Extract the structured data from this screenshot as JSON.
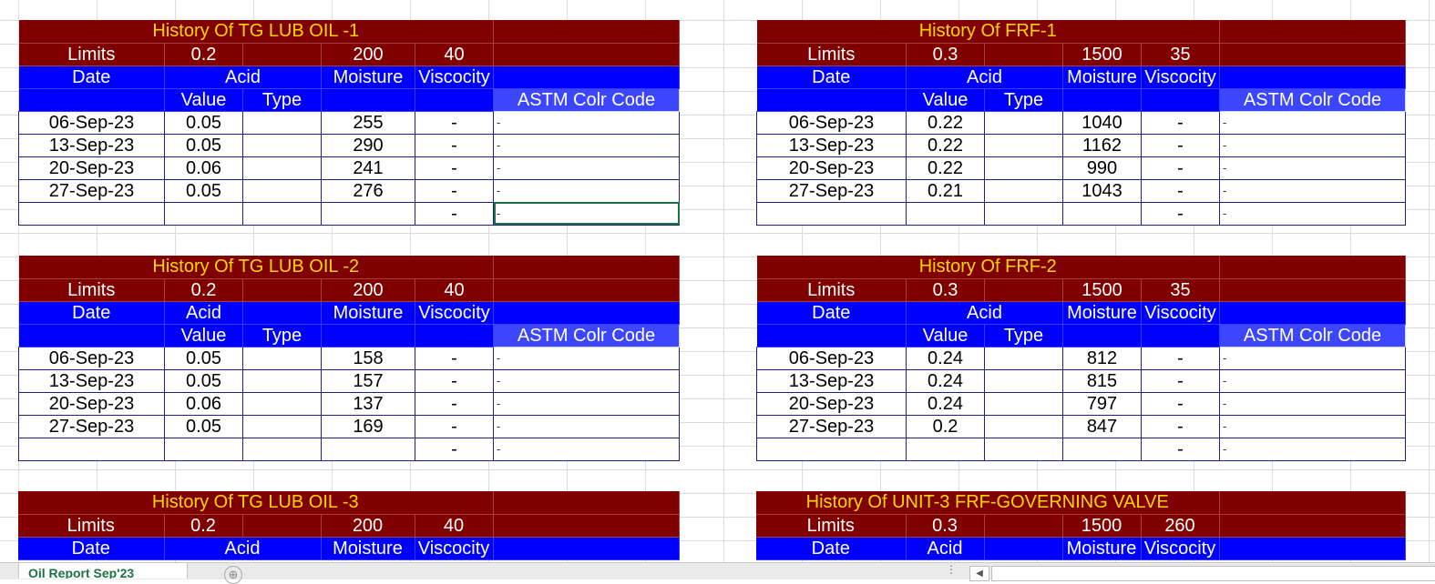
{
  "tables": {
    "t1": {
      "title": "History Of TG LUB OIL -1",
      "limits": {
        "label": "Limits",
        "acid": "0.2",
        "moisture": "200",
        "viscosity": "40"
      },
      "headers": {
        "date": "Date",
        "acid": "Acid",
        "moisture": "Moisture",
        "viscosity": "Viscocity",
        "value": "Value",
        "type": "Type",
        "astm": "ASTM Colr Code"
      },
      "rows": [
        {
          "date": "06-Sep-23",
          "value": "0.05",
          "moisture": "255",
          "viscosity": "-",
          "astm": "-"
        },
        {
          "date": "13-Sep-23",
          "value": "0.05",
          "moisture": "290",
          "viscosity": "-",
          "astm": "-"
        },
        {
          "date": "20-Sep-23",
          "value": "0.06",
          "moisture": "241",
          "viscosity": "-",
          "astm": "-"
        },
        {
          "date": "27-Sep-23",
          "value": "0.05",
          "moisture": "276",
          "viscosity": "-",
          "astm": "-"
        },
        {
          "date": "",
          "value": "",
          "moisture": "",
          "viscosity": "-",
          "astm": "-"
        }
      ]
    },
    "t2": {
      "title": "History Of FRF-1",
      "limits": {
        "label": "Limits",
        "acid": "0.3",
        "moisture": "1500",
        "viscosity": "35"
      },
      "headers": {
        "date": "Date",
        "acid": "Acid",
        "moisture": "Moisture",
        "viscosity": "Viscocity",
        "value": "Value",
        "type": "Type",
        "astm": "ASTM Colr Code"
      },
      "rows": [
        {
          "date": "06-Sep-23",
          "value": "0.22",
          "moisture": "1040",
          "viscosity": "-",
          "astm": "-"
        },
        {
          "date": "13-Sep-23",
          "value": "0.22",
          "moisture": "1162",
          "viscosity": "-",
          "astm": "-"
        },
        {
          "date": "20-Sep-23",
          "value": "0.22",
          "moisture": "990",
          "viscosity": "-",
          "astm": "-"
        },
        {
          "date": "27-Sep-23",
          "value": "0.21",
          "moisture": "1043",
          "viscosity": "-",
          "astm": "-"
        },
        {
          "date": "",
          "value": "",
          "moisture": "",
          "viscosity": "-",
          "astm": "-"
        }
      ]
    },
    "t3": {
      "title": "History Of TG LUB OIL -2",
      "limits": {
        "label": "Limits",
        "acid": "0.2",
        "moisture": "200",
        "viscosity": "40"
      },
      "headers": {
        "date": "Date",
        "acid": "Acid",
        "moisture": "Moisture",
        "viscosity": "Viscocity",
        "value": "Value",
        "type": "Type",
        "astm": "ASTM Colr Code"
      },
      "rows": [
        {
          "date": "06-Sep-23",
          "value": "0.05",
          "moisture": "158",
          "viscosity": "-",
          "astm": "-"
        },
        {
          "date": "13-Sep-23",
          "value": "0.05",
          "moisture": "157",
          "viscosity": "-",
          "astm": "-"
        },
        {
          "date": "20-Sep-23",
          "value": "0.06",
          "moisture": "137",
          "viscosity": "-",
          "astm": "-"
        },
        {
          "date": "27-Sep-23",
          "value": "0.05",
          "moisture": "169",
          "viscosity": "-",
          "astm": "-"
        },
        {
          "date": "",
          "value": "",
          "moisture": "",
          "viscosity": "-",
          "astm": "-"
        }
      ]
    },
    "t4": {
      "title": "History Of FRF-2",
      "limits": {
        "label": "Limits",
        "acid": "0.3",
        "moisture": "1500",
        "viscosity": "35"
      },
      "headers": {
        "date": "Date",
        "acid": "Acid",
        "moisture": "Moisture",
        "viscosity": "Viscocity",
        "value": "Value",
        "type": "Type",
        "astm": "ASTM Colr Code"
      },
      "rows": [
        {
          "date": "06-Sep-23",
          "value": "0.24",
          "moisture": "812",
          "viscosity": "-",
          "astm": "-"
        },
        {
          "date": "13-Sep-23",
          "value": "0.24",
          "moisture": "815",
          "viscosity": "-",
          "astm": "-"
        },
        {
          "date": "20-Sep-23",
          "value": "0.24",
          "moisture": "797",
          "viscosity": "-",
          "astm": "-"
        },
        {
          "date": "27-Sep-23",
          "value": "0.2",
          "moisture": "847",
          "viscosity": "-",
          "astm": "-"
        },
        {
          "date": "",
          "value": "",
          "moisture": "",
          "viscosity": "-",
          "astm": "-"
        }
      ]
    },
    "t5": {
      "title": "History Of TG LUB OIL -3",
      "limits": {
        "label": "Limits",
        "acid": "0.2",
        "moisture": "200",
        "viscosity": "40"
      },
      "headers": {
        "date": "Date",
        "acid": "Acid",
        "moisture": "Moisture",
        "viscosity": "Viscocity"
      }
    },
    "t6": {
      "title": "History Of UNIT-3 FRF-GOVERNING VALVE",
      "limits": {
        "label": "Limits",
        "acid": "0.3",
        "moisture": "1500",
        "viscosity": "260"
      },
      "headers": {
        "date": "Date",
        "acid": "Acid",
        "moisture": "Moisture",
        "viscosity": "Viscocity"
      }
    }
  },
  "sheet_tab": {
    "label": "Oil Report Sep'23",
    "add_icon": "⊕"
  },
  "status_dots": "⋮",
  "colors": {
    "title_bg": "#800000",
    "title_text": "#ffd700",
    "header_bg": "#0000ff",
    "active_tab": "#1e7145"
  }
}
